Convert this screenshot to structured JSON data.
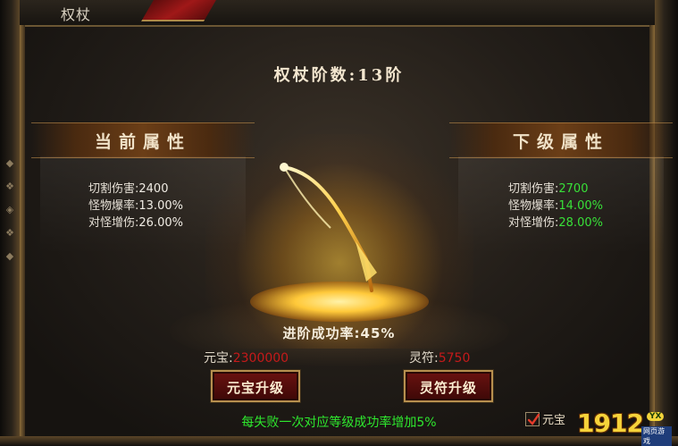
{
  "window": {
    "title": "权杖"
  },
  "stage": {
    "title": "权杖阶数:13阶"
  },
  "current": {
    "header": "当前属性",
    "attrs": [
      {
        "name": "切割伤害:",
        "value": "2400"
      },
      {
        "name": "怪物爆率:",
        "value": "13.00%"
      },
      {
        "name": "对怪增伤:",
        "value": "26.00%"
      }
    ]
  },
  "next": {
    "header": "下级属性",
    "attrs": [
      {
        "name": "切割伤害:",
        "value": "2700"
      },
      {
        "name": "怪物爆率:",
        "value": "14.00%"
      },
      {
        "name": "对怪增伤:",
        "value": "28.00%"
      }
    ]
  },
  "success_rate": "进阶成功率:45%",
  "cost": {
    "yuanbao_label": "元宝:",
    "yuanbao_value": "2300000",
    "lingfu_label": "灵符:",
    "lingfu_value": "5750"
  },
  "buttons": {
    "yuanbao_upgrade": "元宝升级",
    "lingfu_upgrade": "灵符升级"
  },
  "tip": "每失败一次对应等级成功率增加5%",
  "auto_option": {
    "label": "元宝",
    "checked": true
  },
  "logo": {
    "digits": "1912",
    "badge": "YX",
    "sub": "网页游戏"
  },
  "colors": {
    "next_value": "#38e038",
    "cost_value": "#c51a1a",
    "tip": "#2ee82e"
  },
  "icons": {
    "scepter": "scepter-icon",
    "checkmark": "checkmark-icon"
  }
}
